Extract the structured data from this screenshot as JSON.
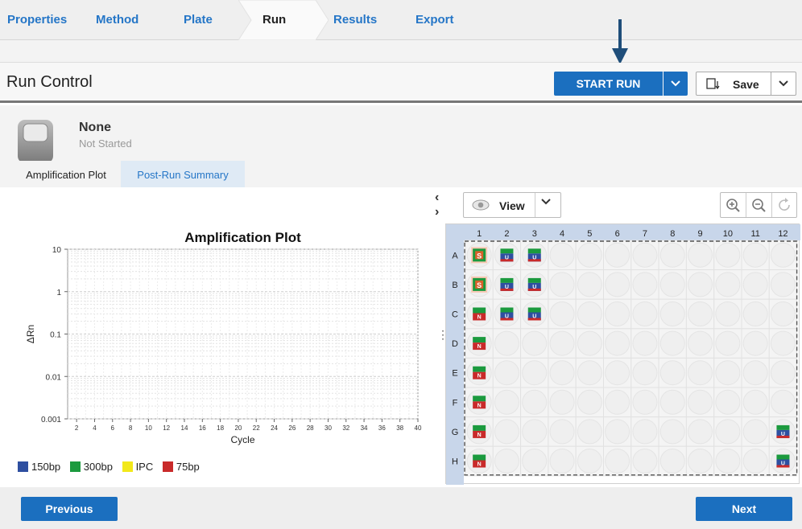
{
  "nav": {
    "tabs": [
      "Properties",
      "Method",
      "Plate",
      "Run",
      "Results",
      "Export"
    ],
    "active": "Run"
  },
  "header": {
    "title": "Run Control",
    "start_run": "START RUN",
    "save": "Save"
  },
  "status": {
    "name": "None",
    "state": "Not Started"
  },
  "subtabs": {
    "active": "Amplification Plot",
    "inactive": "Post-Run Summary"
  },
  "chart_data": {
    "type": "line",
    "title": "Amplification Plot",
    "xlabel": "Cycle",
    "ylabel": "ΔRn",
    "yscale": "log",
    "ylim": [
      0.001,
      10
    ],
    "xlim": [
      1,
      40
    ],
    "yticks": [
      "10",
      "1",
      "0.1",
      "0.01",
      "0.001"
    ],
    "xticks": [
      "2",
      "4",
      "6",
      "8",
      "10",
      "12",
      "14",
      "16",
      "18",
      "20",
      "22",
      "24",
      "26",
      "28",
      "30",
      "32",
      "34",
      "36",
      "38",
      "40"
    ],
    "series": [
      {
        "name": "150bp",
        "color": "#2e4fa0",
        "values": []
      },
      {
        "name": "300bp",
        "color": "#1b9a3e",
        "values": []
      },
      {
        "name": "IPC",
        "color": "#f2e81a",
        "values": []
      },
      {
        "name": "75bp",
        "color": "#c92a2a",
        "values": []
      }
    ],
    "grid": true
  },
  "plate": {
    "view_label": "View",
    "columns": [
      "1",
      "2",
      "3",
      "4",
      "5",
      "6",
      "7",
      "8",
      "9",
      "10",
      "11",
      "12"
    ],
    "rows": [
      "A",
      "B",
      "C",
      "D",
      "E",
      "F",
      "G",
      "H"
    ],
    "wells": {
      "A1": "S",
      "B1": "S",
      "A2": "U",
      "A3": "U",
      "B2": "U",
      "B3": "U",
      "C2": "U",
      "C3": "U",
      "C1": "N",
      "D1": "N",
      "E1": "N",
      "F1": "N",
      "G1": "N",
      "H1": "N",
      "G12": "U",
      "H12": "U"
    }
  },
  "footer": {
    "previous": "Previous",
    "next": "Next"
  }
}
